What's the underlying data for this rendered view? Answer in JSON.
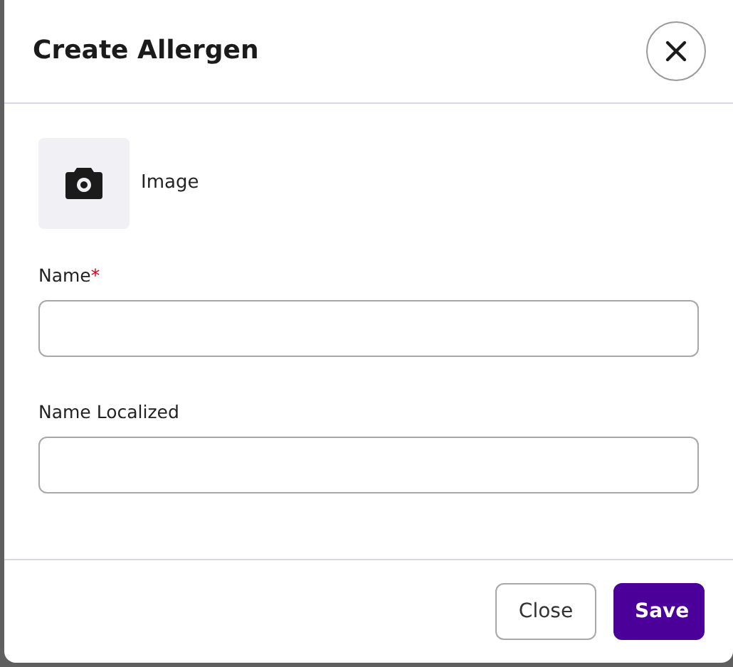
{
  "dialog": {
    "title": "Create Allergen",
    "close_icon_button": true
  },
  "image_picker": {
    "label": "Image"
  },
  "fields": [
    {
      "label": "Name",
      "required_mark": "*"
    },
    {
      "label": "Name Localized"
    }
  ],
  "buttons": [
    {
      "label": "Close",
      "kind": "secondary"
    },
    {
      "label": "Save",
      "kind": "primary"
    }
  ]
}
